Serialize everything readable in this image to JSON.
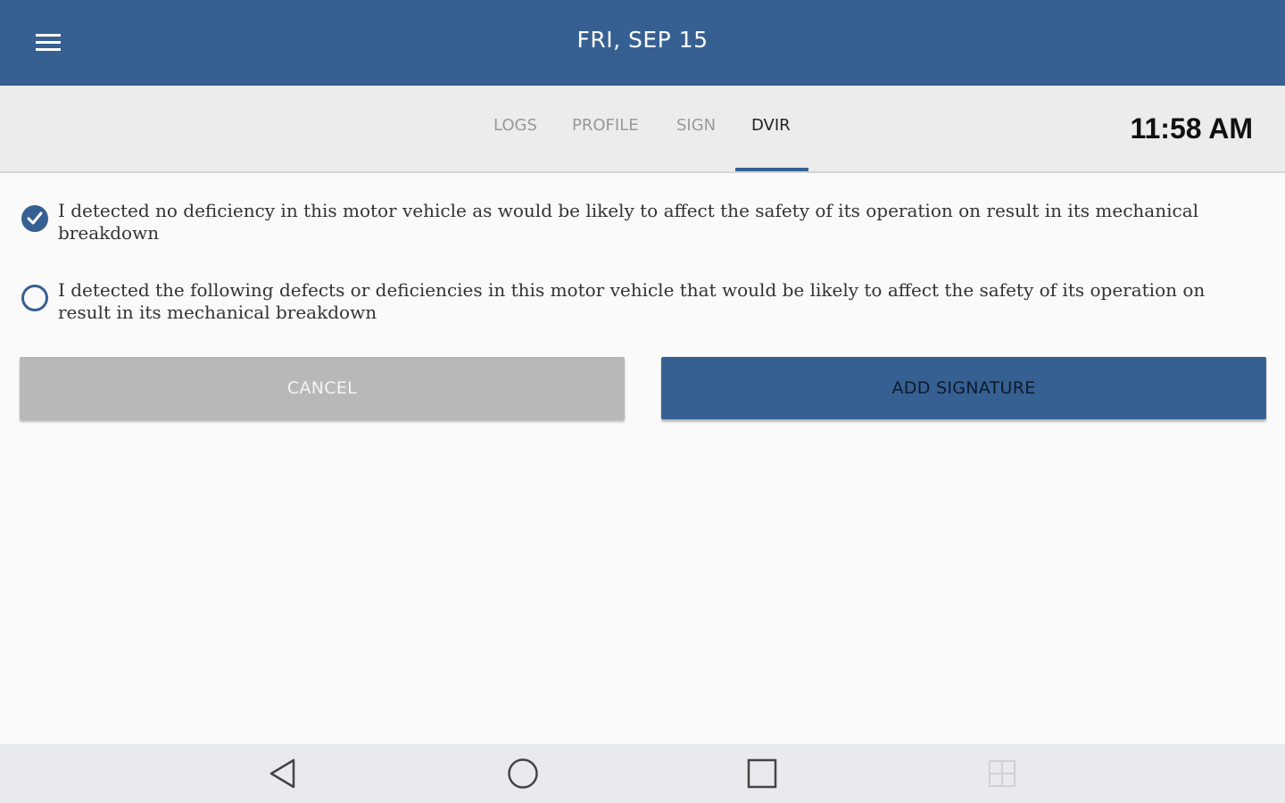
{
  "header": {
    "title": "FRI, SEP 15",
    "menu_icon": "hamburger-menu-icon"
  },
  "tabs": [
    {
      "label": "LOGS",
      "active": false
    },
    {
      "label": "PROFILE",
      "active": false
    },
    {
      "label": "SIGN",
      "active": false
    },
    {
      "label": "DVIR",
      "active": true
    }
  ],
  "clock": "11:58 AM",
  "options": [
    {
      "text": "I detected no deficiency in this motor vehicle as would be likely to affect the safety of its operation on result in its mechanical breakdown",
      "selected": true
    },
    {
      "text": "I detected the following defects or deficiencies in this motor vehicle that would be likely to affect the safety of its operation on result in its mechanical breakdown",
      "selected": false
    }
  ],
  "buttons": {
    "cancel_label": "CANCEL",
    "add_signature_label": "ADD SIGNATURE"
  },
  "colors": {
    "primary": "#366092",
    "tab_bar": "#ececec",
    "cancel_button": "#b8b8b8"
  },
  "nav_bar": {
    "icons": [
      "back-icon",
      "home-icon",
      "recents-icon",
      "multiwindow-icon"
    ]
  }
}
